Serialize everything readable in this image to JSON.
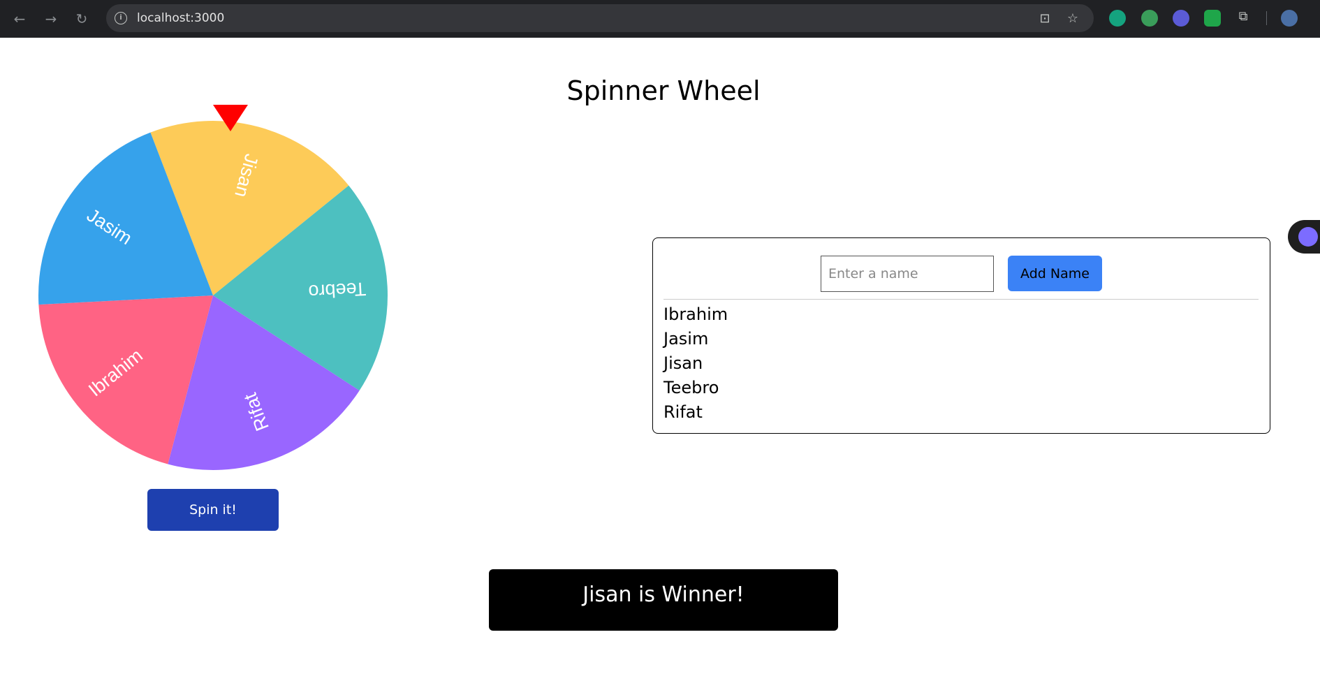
{
  "browser": {
    "url": "localhost:3000",
    "back_icon": "←",
    "forward_icon": "→",
    "reload_icon": "↻",
    "info_icon": "i",
    "install_icon": "⊡",
    "star_icon": "☆",
    "extensions_icon": "⧉"
  },
  "page": {
    "title": "Spinner Wheel"
  },
  "wheel": {
    "segments": [
      {
        "label": "Jisan",
        "color": "#fdcb58"
      },
      {
        "label": "Teebro",
        "color": "#4dc0c0"
      },
      {
        "label": "Rifat",
        "color": "#9966ff"
      },
      {
        "label": "Ibrahim",
        "color": "#ff6384"
      },
      {
        "label": "Jasim",
        "color": "#36a2eb"
      }
    ],
    "pointer_color": "#ff0000",
    "spin_label": "Spin it!"
  },
  "panel": {
    "input_placeholder": "Enter a name",
    "input_value": "",
    "add_label": "Add Name",
    "names": [
      "Ibrahim",
      "Jasim",
      "Jisan",
      "Teebro",
      "Rifat"
    ]
  },
  "result": {
    "winner_text": "Jisan is Winner!"
  }
}
